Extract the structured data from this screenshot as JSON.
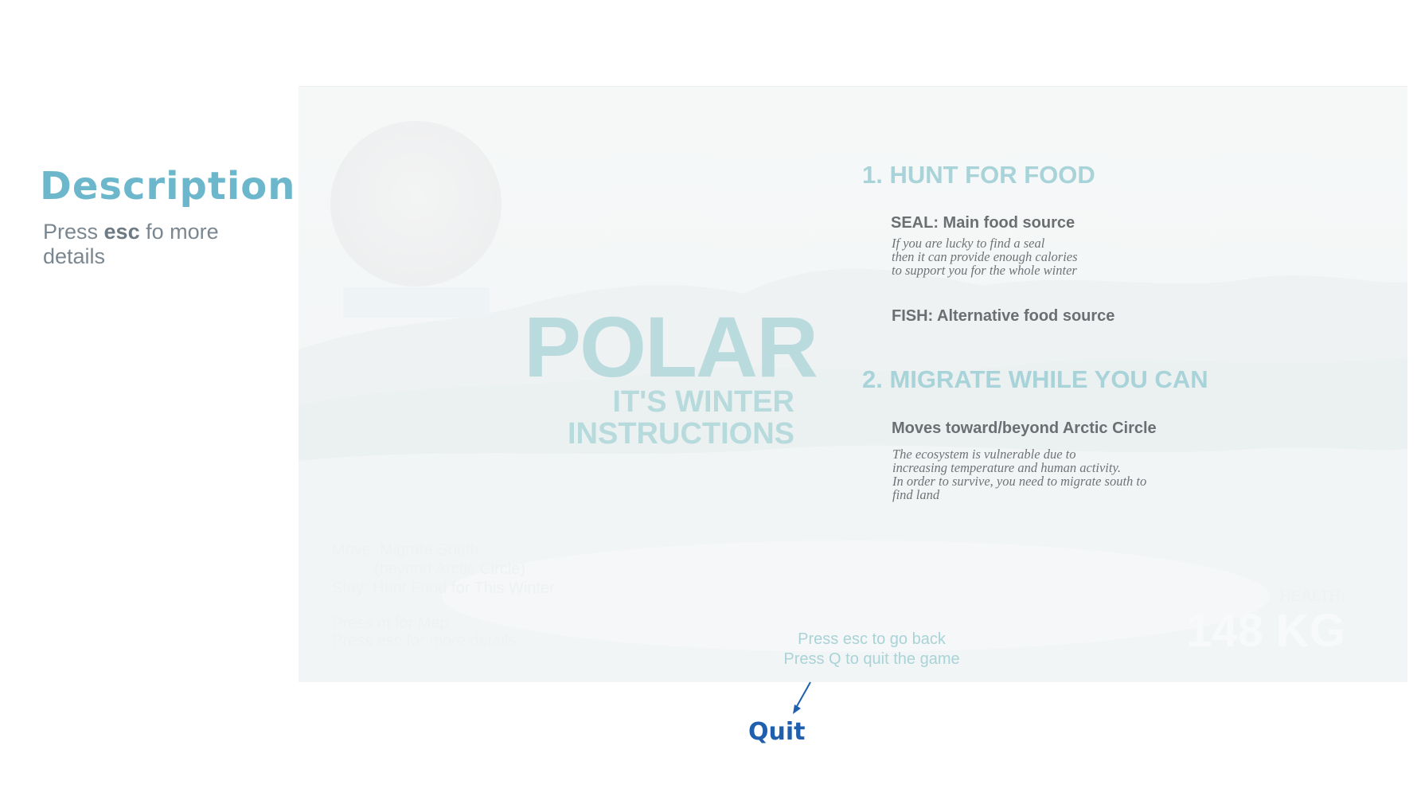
{
  "description": {
    "title": "Description",
    "text_prefix": "Press ",
    "text_key": "esc",
    "text_suffix": " fo more details"
  },
  "game": {
    "title": "POLAR",
    "subtitle_line1": "IT'S WINTER",
    "subtitle_line2": "INSTRUCTIONS",
    "section1": {
      "heading": "1. HUNT FOR FOOD",
      "items": [
        {
          "title": "SEAL: Main food source",
          "desc": [
            "If you are lucky to find a seal",
            "then it can provide enough calories",
            "to support you for the whole winter"
          ]
        },
        {
          "title": "FISH: Alternative food source",
          "desc": []
        }
      ]
    },
    "section2": {
      "heading": "2. MIGRATE WHILE YOU CAN",
      "item_title": "Moves toward/beyond Arctic Circle",
      "desc": [
        "The ecosystem is vulnerable due to",
        "increasing temperature and human activity.",
        "In order to survive, you need to migrate south to",
        "find land"
      ]
    },
    "hud": {
      "move": "Move: Migrate South",
      "move_sub": "(beyond Arctic Circle)",
      "stay": "Stay:   Hunt Food for This Winter",
      "map": "Press m for Map",
      "details": "Press esc for more details",
      "health_label": "HEALTH:",
      "health_value": "148 KG"
    },
    "back_hint": "Press esc to go back",
    "quit_hint": "Press Q to quit the game"
  },
  "annotation": {
    "quit_label": "Quit",
    "arrow_color": "#1f5fae"
  },
  "colors": {
    "accent": "#6cb7cb",
    "title_teal": "#b9dbdd",
    "heading_teal": "#a8d3d8",
    "annotation_blue": "#1f5fae"
  }
}
